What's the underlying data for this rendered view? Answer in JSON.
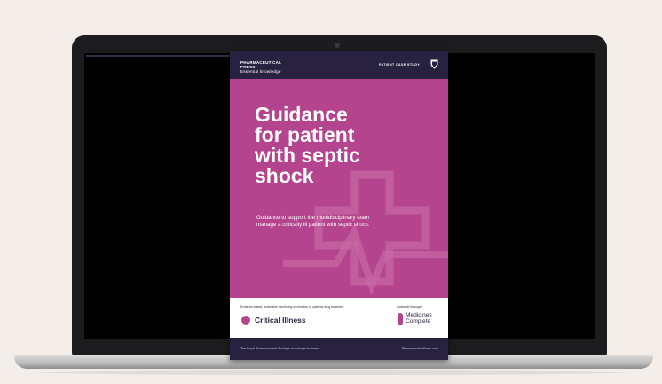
{
  "cover": {
    "publisher_line1": "PHARMACEUTICAL",
    "publisher_line2": "PRESS",
    "publisher_tagline": "Essential knowledge",
    "case_label": "PATIENT CASE STUDY",
    "title_lines": [
      "Guidance",
      "for patient",
      "with septic",
      "shock"
    ],
    "description": "Guidance to support the multidisciplinary team manage a critically ill patient with septic shock.",
    "bottom_note": "Evidence-based, actionable monitoring information to optimise drug treatment",
    "series_name": "Critical Illness",
    "available_label": "Available through",
    "mc_line1": "Medicines",
    "mc_line2": "Complete",
    "footer_left": "The Royal Pharmaceutical Society's knowledge business",
    "footer_right": "PharmaceuticalPress.com"
  },
  "colors": {
    "cover_magenta": "#b4448e",
    "cover_navy": "#282240",
    "background": "#f3eee9"
  }
}
